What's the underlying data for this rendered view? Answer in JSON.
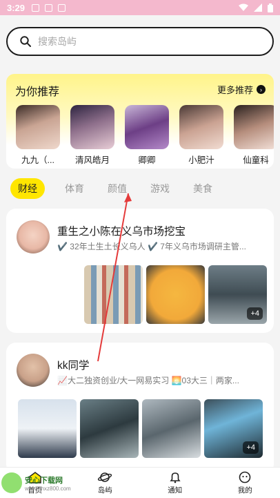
{
  "status": {
    "time": "3:29"
  },
  "search": {
    "placeholder": "搜索岛屿"
  },
  "recommend": {
    "title": "为你推荐",
    "more": "更多推荐",
    "items": [
      {
        "name": "九九（..."
      },
      {
        "name": "清风皓月"
      },
      {
        "name": "卿卿"
      },
      {
        "name": "小肥汁"
      },
      {
        "name": "仙童科"
      }
    ]
  },
  "tabs": [
    "财经",
    "体育",
    "颜值",
    "游戏",
    "美食"
  ],
  "posts": [
    {
      "name": "重生之小陈在义乌市场挖宝",
      "desc": "✔️ 32年土生土长义乌人 ✔️ 7年义乌市场调研主管...",
      "more": "+4"
    },
    {
      "name": "kk同学",
      "desc": "📈大二独资创业/大一网易实习 🌅03大三｜两家...",
      "more": "+4"
    }
  ],
  "tabbar": [
    "首页",
    "岛屿",
    "通知",
    "我的"
  ],
  "watermark": {
    "text": "安心下载网",
    "sub": "www.anxz800.com"
  }
}
